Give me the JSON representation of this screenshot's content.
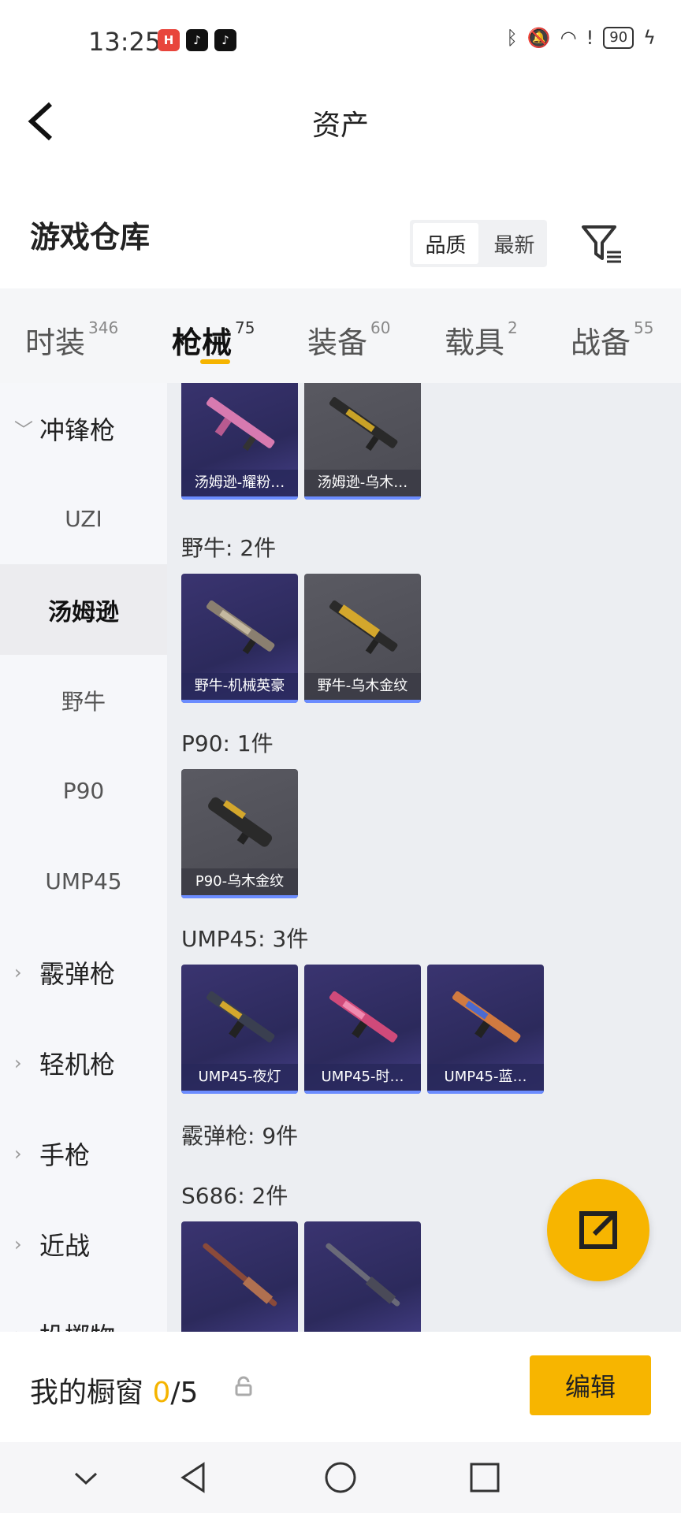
{
  "status_bar": {
    "time": "13:25",
    "battery": "90"
  },
  "header": {
    "title": "资产"
  },
  "warehouse": {
    "title": "游戏仓库",
    "sort_quality": "品质",
    "sort_newest": "最新"
  },
  "tabs": [
    {
      "label": "时装",
      "count": "346"
    },
    {
      "label": "枪械",
      "count": "75"
    },
    {
      "label": "装备",
      "count": "60"
    },
    {
      "label": "载具",
      "count": "2"
    },
    {
      "label": "战备",
      "count": "55"
    }
  ],
  "sidebar": {
    "smg": "冲锋枪",
    "uzi": "UZI",
    "thompson": "汤姆逊",
    "bizon": "野牛",
    "p90": "P90",
    "ump45": "UMP45",
    "shotgun": "霰弹枪",
    "lmg": "轻机枪",
    "pistol": "手枪",
    "melee": "近战",
    "throwable": "投掷物"
  },
  "groups": {
    "bizon_header": "野牛: 2件",
    "p90_header": "P90: 1件",
    "ump45_header": "UMP45: 3件",
    "shotgun_header": "霰弹枪: 9件",
    "s686_header": "S686: 2件"
  },
  "items": {
    "thompson_1": "汤姆逊-耀粉…",
    "thompson_2": "汤姆逊-乌木…",
    "bizon_1": "野牛-机械英豪",
    "bizon_2": "野牛-乌木金纹",
    "p90_1": "P90-乌木金纹",
    "ump_1": "UMP45-夜灯",
    "ump_2": "UMP45-时…",
    "ump_3": "UMP45-蓝…"
  },
  "showcase": {
    "title": "我的橱窗",
    "count": "0",
    "total": "/5",
    "edit_label": "编辑"
  },
  "colors": {
    "accent": "#f7b500",
    "rare_bg": "#2c2a5c",
    "common_bg": "#4a4a52"
  }
}
